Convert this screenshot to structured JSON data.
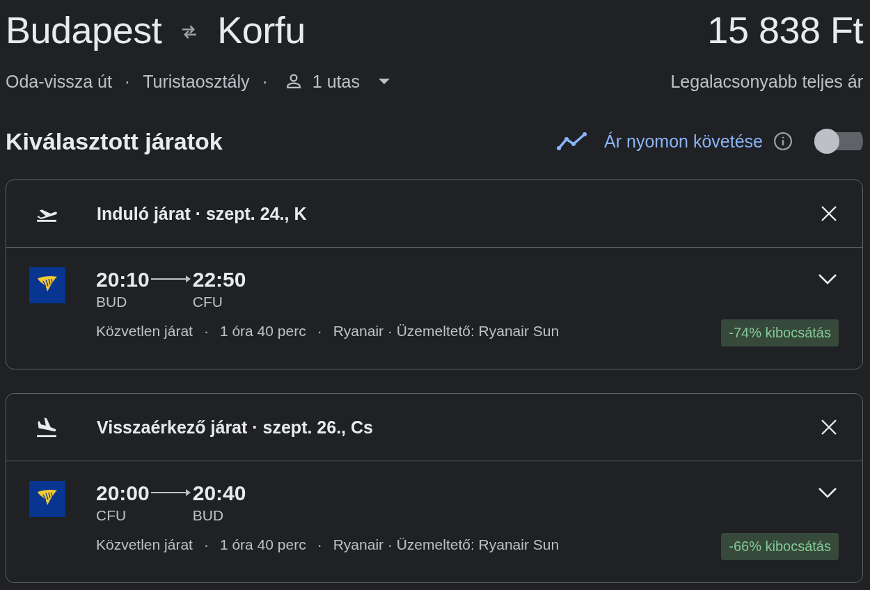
{
  "header": {
    "origin": "Budapest",
    "destination": "Korfu",
    "price": "15 838 Ft"
  },
  "trip": {
    "items": [
      "Oda-vissza út",
      "·",
      "Turistaosztály",
      "·"
    ],
    "passengers": "1 utas",
    "price_note": "Legalacsonyabb teljes ár"
  },
  "section": {
    "title": "Kiválasztott járatok",
    "tracking_label": "Ár nyomon követése",
    "tracking_on": false
  },
  "flights": [
    {
      "kind": "departure",
      "heading": "Induló járat · szept. 24., K",
      "depart_time": "20:10",
      "arrive_time": "22:50",
      "from": "BUD",
      "to": "CFU",
      "details": [
        "Közvetlen járat",
        "·",
        "1 óra 40 perc",
        "·",
        "Ryanair · Üzemeltető: Ryanair Sun"
      ],
      "emissions": "-74% kibocsátás"
    },
    {
      "kind": "return",
      "heading": "Visszaérkező járat · szept. 26., Cs",
      "depart_time": "20:00",
      "arrive_time": "20:40",
      "from": "CFU",
      "to": "BUD",
      "details": [
        "Közvetlen járat",
        "·",
        "1 óra 40 perc",
        "·",
        "Ryanair · Üzemeltető: Ryanair Sun"
      ],
      "emissions": "-66% kibocsátás"
    }
  ]
}
